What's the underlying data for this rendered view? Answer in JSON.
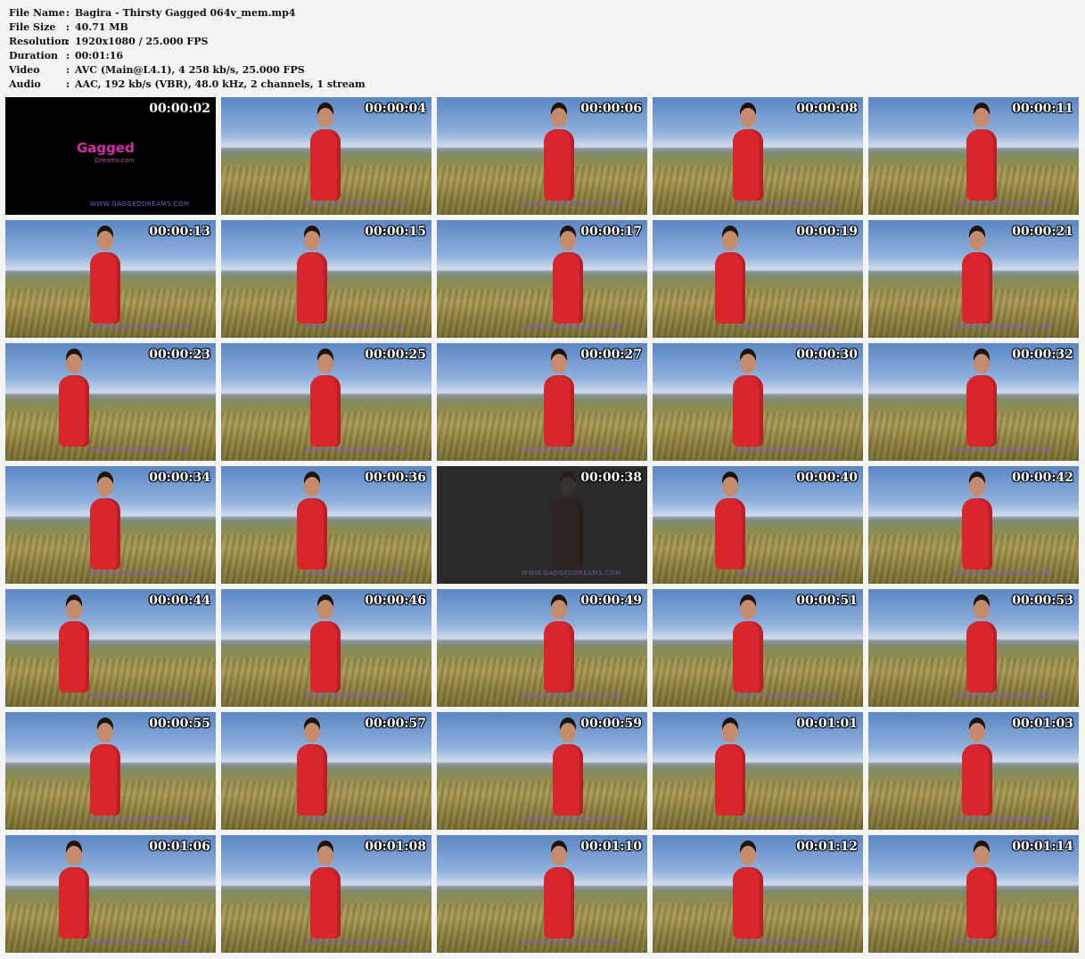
{
  "info": [
    {
      "label": "File Name",
      "value": "Bagira - Thirsty Gagged 064v_mem.mp4"
    },
    {
      "label": "File Size",
      "value": "40.71 MB"
    },
    {
      "label": "Resolution",
      "value": "1920x1080 / 25.000 FPS"
    },
    {
      "label": "Duration",
      "value": "00:01:16"
    },
    {
      "label": "Video",
      "value": "AVC (Main@L4.1), 4 258 kb/s, 25.000 FPS"
    },
    {
      "label": "Audio",
      "value": "AAC, 192 kb/s (VBR), 48.0 kHz, 2 channels, 1 stream"
    }
  ],
  "separator": ":",
  "logo": {
    "main": "Gagged",
    "sub": "Dreams.com"
  },
  "watermark": "WWW.GAGGEDDREAMS.COM",
  "thumbnails": [
    "00:00:02",
    "00:00:04",
    "00:00:06",
    "00:00:08",
    "00:00:11",
    "00:00:13",
    "00:00:15",
    "00:00:17",
    "00:00:19",
    "00:00:21",
    "00:00:23",
    "00:00:25",
    "00:00:27",
    "00:00:30",
    "00:00:32",
    "00:00:34",
    "00:00:36",
    "00:00:38",
    "00:00:40",
    "00:00:42",
    "00:00:44",
    "00:00:46",
    "00:00:49",
    "00:00:51",
    "00:00:53",
    "00:00:55",
    "00:00:57",
    "00:00:59",
    "00:01:01",
    "00:01:03",
    "00:01:06",
    "00:01:08",
    "00:01:10",
    "00:01:12",
    "00:01:14"
  ],
  "thumb_styles": {
    "0": "dark",
    "17": "dim"
  },
  "colors": {
    "background": "#f4f4f4",
    "swimsuit": "#d9262c",
    "logo": "#d62aa8",
    "watermark": "#7d5bd0"
  }
}
